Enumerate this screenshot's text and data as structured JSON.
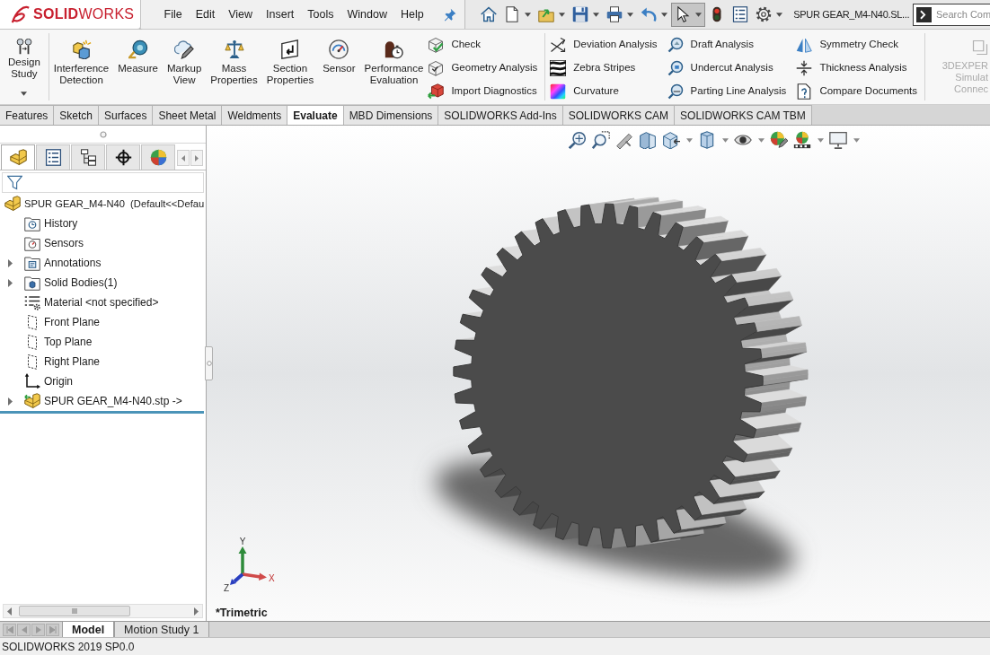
{
  "title_bar": {
    "logo": "**SOLID**WORKS",
    "menu": [
      "File",
      "Edit",
      "View",
      "Insert",
      "Tools",
      "Window",
      "Help"
    ],
    "quick_access": [
      {
        "kind": "home",
        "has_menu": false,
        "selected": false
      },
      {
        "kind": "new",
        "has_menu": true,
        "selected": false
      },
      {
        "kind": "open",
        "has_menu": true,
        "selected": false
      },
      {
        "kind": "save",
        "has_menu": true,
        "selected": false
      },
      {
        "kind": "print",
        "has_menu": true,
        "selected": false
      },
      {
        "kind": "undo",
        "has_menu": true,
        "selected": false
      },
      {
        "kind": "select",
        "has_menu": true,
        "selected": true
      },
      {
        "kind": "rebuild",
        "has_menu": false,
        "selected": false
      },
      {
        "kind": "properties",
        "has_menu": false,
        "selected": false
      },
      {
        "kind": "options",
        "has_menu": true,
        "selected": false
      }
    ],
    "document_title": "SPUR GEAR_M4-N40.SL...",
    "search": {
      "placeholder": "Search Com"
    }
  },
  "ribbon": {
    "groups": [
      {
        "buttons": [
          {
            "kind": "design",
            "label": "Design Study",
            "has_menu": true
          }
        ]
      },
      {
        "buttons": [
          {
            "kind": "interference",
            "label": "Interference Detection",
            "has_menu": false
          },
          {
            "kind": "measure",
            "label": "Measure",
            "has_menu": false
          },
          {
            "kind": "markup",
            "label": "Markup View",
            "has_menu": false
          },
          {
            "kind": "mass",
            "label": "Mass Properties",
            "has_menu": false
          },
          {
            "kind": "section",
            "label": "Section Properties",
            "has_menu": false
          },
          {
            "kind": "sensor",
            "label": "Sensor",
            "has_menu": false
          },
          {
            "kind": "performance",
            "label": "Performance Evaluation",
            "has_menu": false
          }
        ],
        "columns": [
          [
            {
              "kind": "check",
              "label": "Check"
            },
            {
              "kind": "geometry",
              "label": "Geometry Analysis"
            },
            {
              "kind": "import",
              "label": "Import Diagnostics"
            }
          ]
        ]
      },
      {
        "columns": [
          [
            {
              "kind": "deviation",
              "label": "Deviation Analysis"
            },
            {
              "kind": "zebra",
              "label": "Zebra Stripes"
            },
            {
              "kind": "curvature",
              "label": "Curvature"
            }
          ],
          [
            {
              "kind": "draft",
              "label": "Draft Analysis"
            },
            {
              "kind": "undercut",
              "label": "Undercut Analysis"
            },
            {
              "kind": "parting",
              "label": "Parting Line Analysis"
            }
          ],
          [
            {
              "kind": "symmetry",
              "label": "Symmetry Check"
            },
            {
              "kind": "thickness",
              "label": "Thickness Analysis"
            },
            {
              "kind": "compare",
              "label": "Compare Documents"
            }
          ]
        ]
      }
    ],
    "add_in": {
      "lines": [
        "3DEXPER",
        "Simulat",
        "Connec"
      ],
      "disabled": true
    }
  },
  "command_tabs": [
    {
      "label": "Features",
      "selected": false
    },
    {
      "label": "Sketch",
      "selected": false
    },
    {
      "label": "Surfaces",
      "selected": false
    },
    {
      "label": "Sheet Metal",
      "selected": false
    },
    {
      "label": "Weldments",
      "selected": false
    },
    {
      "label": "Evaluate",
      "selected": true
    },
    {
      "label": "MBD Dimensions",
      "selected": false
    },
    {
      "label": "SOLIDWORKS Add-Ins",
      "selected": false
    },
    {
      "label": "SOLIDWORKS CAM",
      "selected": false
    },
    {
      "label": "SOLIDWORKS CAM TBM",
      "selected": false
    }
  ],
  "feature_manager": {
    "tabs": [
      {
        "kind": "features",
        "selected": true
      },
      {
        "kind": "properties",
        "selected": false
      },
      {
        "kind": "configurations",
        "selected": false
      },
      {
        "kind": "dimxpert",
        "selected": false
      },
      {
        "kind": "display",
        "selected": false
      }
    ],
    "tree": [
      {
        "label": "SPUR GEAR_M4-N40  (Default<<Defau",
        "kind": "part",
        "expandable": false,
        "children": [
          {
            "label": "History",
            "kind": "history",
            "expandable": false
          },
          {
            "label": "Sensors",
            "kind": "sensors",
            "expandable": false
          },
          {
            "label": "Annotations",
            "kind": "annotations",
            "expandable": true
          },
          {
            "label": "Solid Bodies(1)",
            "kind": "bodies",
            "expandable": true
          },
          {
            "label": "Material <not specified>",
            "kind": "material",
            "expandable": false
          },
          {
            "label": "Front Plane",
            "kind": "plane",
            "expandable": false
          },
          {
            "label": "Top Plane",
            "kind": "plane",
            "expandable": false
          },
          {
            "label": "Right Plane",
            "kind": "plane",
            "expandable": false
          },
          {
            "label": "Origin",
            "kind": "origin",
            "expandable": false
          },
          {
            "label": "SPUR GEAR_M4-N40.stp ->",
            "kind": "import",
            "expandable": true
          }
        ]
      }
    ]
  },
  "viewport": {
    "heads_up_toolbar": [
      {
        "kind": "zoom_fit",
        "has_menu": false
      },
      {
        "kind": "zoom_area",
        "has_menu": false
      },
      {
        "kind": "previous",
        "has_menu": false
      },
      {
        "kind": "section",
        "has_menu": false
      },
      {
        "kind": "orientation",
        "has_menu": true
      },
      {
        "kind": "display",
        "has_menu": true
      },
      {
        "kind": "hide_show",
        "has_menu": true
      },
      {
        "kind": "appearance",
        "has_menu": false
      },
      {
        "kind": "scene",
        "has_menu": true
      },
      {
        "kind": "view_settings",
        "has_menu": true
      }
    ],
    "triad": {
      "x": "X",
      "y": "Y",
      "z": "Z"
    },
    "view_name": "*Trimetric"
  },
  "bottom_tabs": [
    {
      "label": "Model",
      "selected": true
    },
    {
      "label": "Motion Study 1",
      "selected": false
    }
  ],
  "status_bar": "SOLIDWORKS 2019 SP0.0"
}
